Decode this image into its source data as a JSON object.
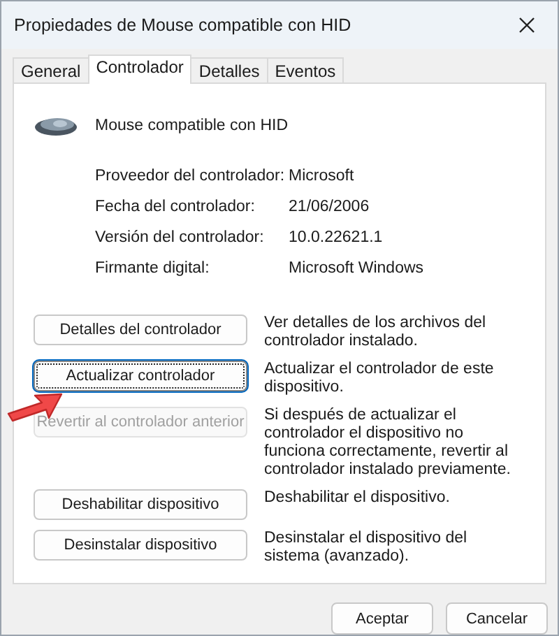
{
  "window": {
    "title": "Propiedades de Mouse compatible con HID"
  },
  "tabs": [
    {
      "label": "General",
      "selected": false
    },
    {
      "label": "Controlador",
      "selected": true
    },
    {
      "label": "Detalles",
      "selected": false
    },
    {
      "label": "Eventos",
      "selected": false
    }
  ],
  "device": {
    "name": "Mouse compatible con HID"
  },
  "info": [
    {
      "label": "Proveedor del controlador:",
      "value": "Microsoft"
    },
    {
      "label": "Fecha del controlador:",
      "value": "21/06/2006"
    },
    {
      "label": "Versión del controlador:",
      "value": "10.0.22621.1"
    },
    {
      "label": "Firmante digital:",
      "value": "Microsoft Windows"
    }
  ],
  "actions": [
    {
      "button": "Detalles del controlador",
      "description": "Ver detalles de los archivos del controlador instalado.",
      "focused": false,
      "disabled": false
    },
    {
      "button": "Actualizar controlador",
      "description": "Actualizar el controlador de este dispositivo.",
      "focused": true,
      "disabled": false
    },
    {
      "button": "Revertir al controlador anterior",
      "description": "Si después de actualizar el controlador el dispositivo no funciona correctamente, revertir al controlador instalado previamente.",
      "focused": false,
      "disabled": true
    },
    {
      "button": "Deshabilitar dispositivo",
      "description": "Deshabilitar el dispositivo.",
      "focused": false,
      "disabled": false
    },
    {
      "button": "Desinstalar dispositivo",
      "description": "Desinstalar el dispositivo del sistema (avanzado).",
      "focused": false,
      "disabled": false
    }
  ],
  "footer_buttons": [
    "Aceptar",
    "Cancelar"
  ],
  "annotation": {
    "kind": "arrow"
  }
}
